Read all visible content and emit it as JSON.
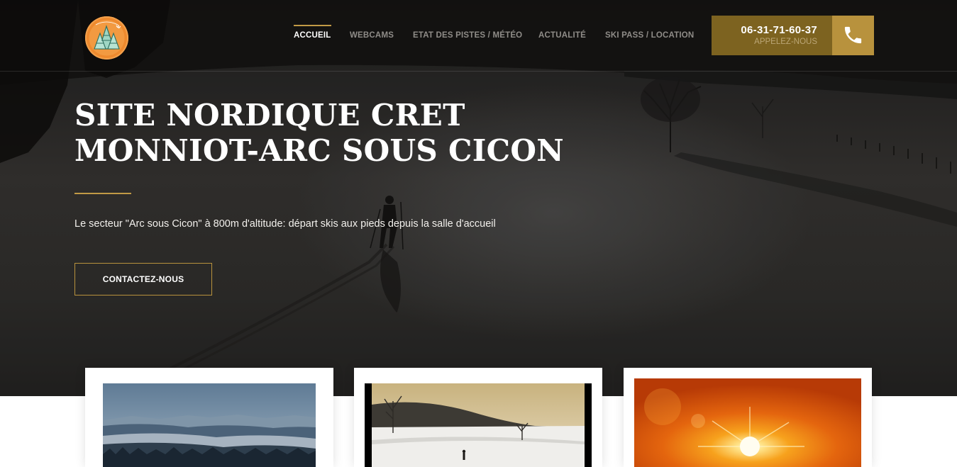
{
  "header": {
    "logo_icon": "ski-resort-logo-icon",
    "nav": [
      {
        "label": "ACCUEIL",
        "active": true
      },
      {
        "label": "WEBCAMS",
        "active": false
      },
      {
        "label": "ETAT DES PISTES / MÉTÉO",
        "active": false
      },
      {
        "label": "ACTUALITÉ",
        "active": false
      },
      {
        "label": "SKI PASS / LOCATION",
        "active": false
      }
    ],
    "phone": {
      "number": "06-31-71-60-37",
      "sub": "APPELEZ-NOUS",
      "icon": "phone-icon"
    }
  },
  "hero": {
    "title_line1": "SITE NORDIQUE CRET",
    "title_line2": "MONNIOT-ARC SOUS CICON",
    "description": "Le secteur \"Arc sous Cicon\" à 800m d'altitude: départ skis aux pieds depuis la salle d'accueil",
    "cta_label": "CONTACTEZ-NOUS"
  },
  "cards": [
    {
      "image": "mountain-panorama-image"
    },
    {
      "image": "snowy-field-skier-image"
    },
    {
      "image": "sunset-sun-image"
    }
  ],
  "colors": {
    "accent_gold": "#c19a45",
    "phone_box": "#7d6320",
    "phone_icon_box": "#b8923d",
    "logo_orange": "#ee8a2e"
  }
}
